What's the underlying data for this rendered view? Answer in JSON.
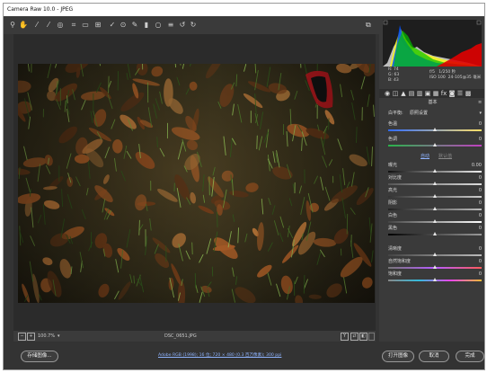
{
  "window": {
    "title": "Camera Raw 10.0 - JPEG"
  },
  "toolbar": {
    "tools": [
      "zoom-icon",
      "hand-icon",
      "white-balance-icon",
      "color-sampler-icon",
      "target-adjust-icon",
      "crop-icon",
      "straighten-icon",
      "transform-icon",
      "spot-removal-icon",
      "red-eye-icon",
      "adjustment-brush-icon",
      "graduated-filter-icon",
      "radial-filter-icon",
      "preferences-list-icon",
      "rotate-ccw-icon",
      "rotate-cw-icon"
    ],
    "glyphs": [
      "⚲",
      "✋",
      "⁄",
      "⁄",
      "◎",
      "⌗",
      "▭",
      "⊞",
      "✓",
      "⊙",
      "✎",
      "▮",
      "○",
      "≡",
      "↺",
      "↻"
    ]
  },
  "histogram": {
    "colors": [
      "#e00000",
      "#00c000",
      "#0050ff",
      "#ffff00",
      "#ffffff"
    ]
  },
  "readout": {
    "r": "R:",
    "r_val": "74",
    "g": "G:",
    "g_val": "63",
    "b": "B:",
    "b_val": "43",
    "aperture": "f/5",
    "shutter": "1/250 秒",
    "iso": "ISO 100",
    "lens": "24-105@35 毫米"
  },
  "panel": {
    "title": "基本",
    "wb_label": "白平衡:",
    "wb_value": "原照设置",
    "auto": "自动",
    "default": "默认值",
    "sliders": [
      {
        "label": "色温",
        "value": "0",
        "pos": 0.5
      },
      {
        "label": "色调",
        "value": "0",
        "pos": 0.5
      },
      {
        "label": "曝光",
        "value": "0.00",
        "pos": 0.5
      },
      {
        "label": "对比度",
        "value": "0",
        "pos": 0.5
      },
      {
        "label": "高光",
        "value": "0",
        "pos": 0.5
      },
      {
        "label": "阴影",
        "value": "0",
        "pos": 0.5
      },
      {
        "label": "白色",
        "value": "0",
        "pos": 0.5
      },
      {
        "label": "黑色",
        "value": "0",
        "pos": 0.5
      },
      {
        "label": "清晰度",
        "value": "0",
        "pos": 0.5
      },
      {
        "label": "自然饱和度",
        "value": "0",
        "pos": 0.5
      },
      {
        "label": "饱和度",
        "value": "0",
        "pos": 0.5
      }
    ]
  },
  "status": {
    "zoom": "100.7%",
    "filename": "DSC_0651.JPG"
  },
  "bottom": {
    "save": "存储图像...",
    "workflow": "Adobe RGB (1998); 16 位; 720 × 480 (0.3 百万像素); 300 ppi",
    "open": "打开图像",
    "cancel": "取消",
    "done": "完成"
  }
}
